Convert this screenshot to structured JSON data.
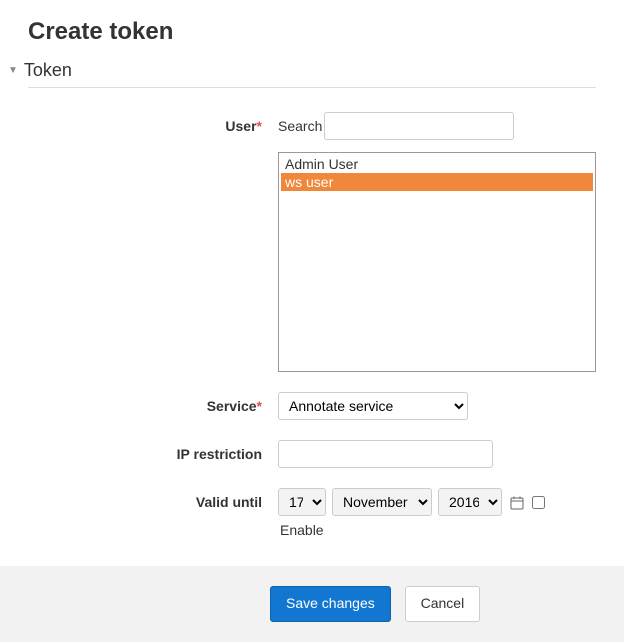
{
  "page": {
    "title": "Create token",
    "section": "Token"
  },
  "form": {
    "user_label": "User",
    "search_label": "Search",
    "search_value": "",
    "user_options": [
      "Admin User",
      "ws user"
    ],
    "user_selected_index": 1,
    "service_label": "Service",
    "service_value": "Annotate service",
    "ip_label": "IP restriction",
    "ip_value": "",
    "valid_label": "Valid until",
    "valid_day": "17",
    "valid_month": "November",
    "valid_year": "2016",
    "enable_label": "Enable",
    "enable_checked": false
  },
  "actions": {
    "save": "Save changes",
    "cancel": "Cancel"
  }
}
